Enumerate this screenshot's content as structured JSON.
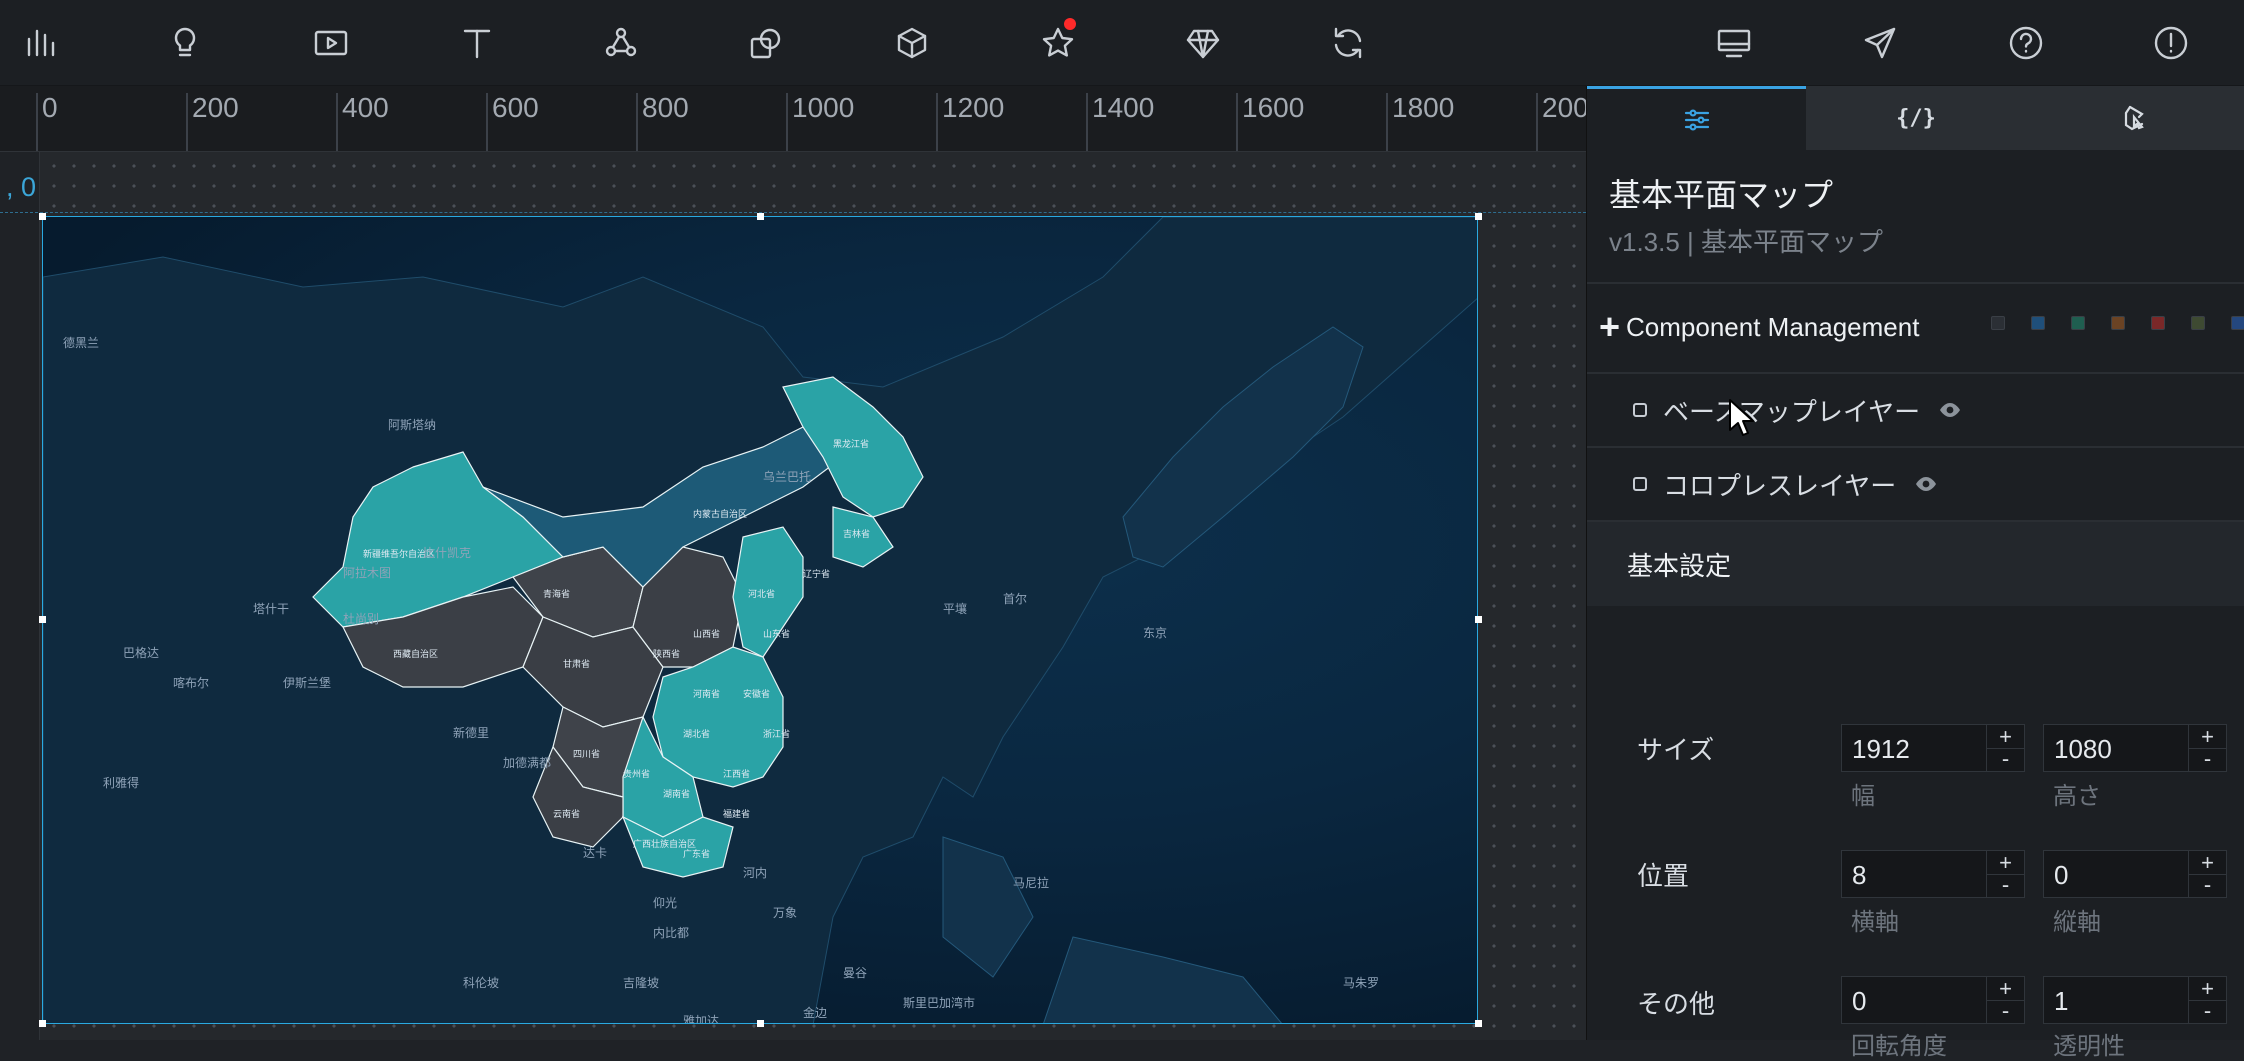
{
  "toolbar": {
    "left_icons": [
      "bar-chart-icon",
      "lightbulb-icon",
      "media-play-icon",
      "text-icon",
      "network-icon",
      "shapes-icon",
      "cube-icon",
      "star-icon",
      "diamond-icon",
      "refresh-icon"
    ],
    "right_icons": [
      "monitor-icon",
      "send-icon",
      "help-icon",
      "alert-icon"
    ],
    "notification_color": "#ff2a2a"
  },
  "ruler": {
    "labels": [
      "0",
      "200",
      "400",
      "600",
      "800",
      "1000",
      "1200",
      "1400",
      "1600",
      "1800",
      "200"
    ],
    "origin_label": ", 0"
  },
  "map": {
    "labels": [
      "阿斯塔纳",
      "乌兰巴托",
      "比什凯克",
      "阿拉木图",
      "杜尚别",
      "塔什干",
      "喀布尔",
      "伊斯兰堡",
      "新德里",
      "加德满都",
      "达卡",
      "仰光",
      "内比都",
      "万象",
      "河内",
      "曼谷",
      "金边",
      "首尔",
      "平壤",
      "东京",
      "马尼拉",
      "斯里巴加湾市",
      "马朱罗",
      "德黑兰",
      "巴格达",
      "利雅得",
      "科伦坡",
      "吉隆坡",
      "雅加达"
    ],
    "provinces": [
      "新疆维吾尔自治区",
      "西藏自治区",
      "青海省",
      "甘肃省",
      "四川省",
      "内蒙古自治区",
      "黑龙江省",
      "吉林省",
      "辽宁省",
      "河北省",
      "山东省",
      "河南省",
      "湖北省",
      "湖南省",
      "江西省",
      "浙江省",
      "安徽省",
      "贵州省",
      "云南省",
      "广西壮族自治区",
      "广东省",
      "福建省",
      "陕西省",
      "山西省"
    ]
  },
  "panel": {
    "tabs": [
      "settings-tab",
      "code-tab",
      "interaction-tab"
    ],
    "code_tab_label": "{/}",
    "title": "基本平面マップ",
    "version": "v1.3.5 | 基本平面マップ",
    "component_management": "Component Management",
    "swatch_colors": [
      "#2b2f35",
      "#1f4f7a",
      "#1f5e50",
      "#6b4324",
      "#7a2828",
      "#3e4a32",
      "#24477e"
    ],
    "layers": [
      {
        "name": "ベースマップレイヤー"
      },
      {
        "name": "コロプレスレイヤー"
      }
    ],
    "section_title": "基本設定",
    "size": {
      "label": "サイズ",
      "width": "1912",
      "width_label": "幅",
      "height": "1080",
      "height_label": "高さ"
    },
    "position": {
      "label": "位置",
      "x": "8",
      "x_label": "横軸",
      "y": "0",
      "y_label": "縦軸"
    },
    "other": {
      "label": "その他",
      "rotation": "0",
      "rotation_label": "回転角度",
      "opacity": "1",
      "opacity_label": "透明性"
    },
    "stepper_plus": "+",
    "stepper_minus": "-"
  }
}
